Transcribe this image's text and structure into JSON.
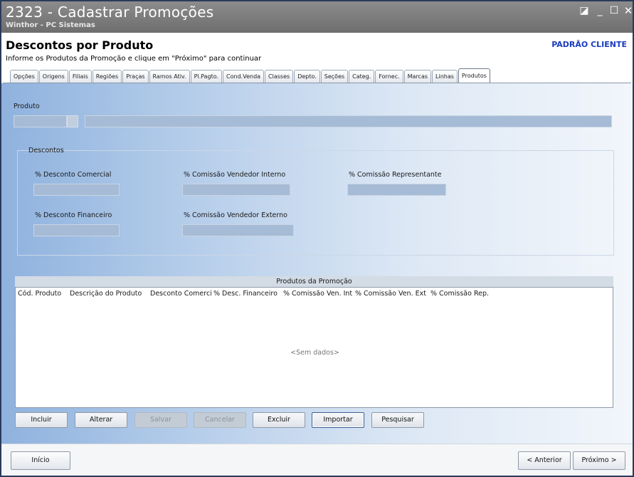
{
  "window": {
    "title": "2323 - Cadastrar Promoções",
    "subtitle": "Winthor - PC Sistemas",
    "controls": {
      "restore": "◪",
      "minimize": "_",
      "maximize": "☐",
      "close": "✕"
    }
  },
  "header": {
    "title": "Descontos por Produto",
    "instruction": "Informe os Produtos da Promoção e clique em \"Próximo\" para continuar",
    "profile_link": "PADRÃO CLIENTE"
  },
  "tabs": [
    {
      "label": "Opções"
    },
    {
      "label": "Origens"
    },
    {
      "label": "Filiais"
    },
    {
      "label": "Regiões"
    },
    {
      "label": "Praças"
    },
    {
      "label": "Ramos Ativ."
    },
    {
      "label": "Pl.Pagto."
    },
    {
      "label": "Cond.Venda"
    },
    {
      "label": "Classes"
    },
    {
      "label": "Depto."
    },
    {
      "label": "Seções"
    },
    {
      "label": "Categ."
    },
    {
      "label": "Fornec."
    },
    {
      "label": "Marcas"
    },
    {
      "label": "Linhas"
    },
    {
      "label": "Produtos"
    }
  ],
  "active_tab": "Produtos",
  "produto": {
    "label": "Produto",
    "code_value": "",
    "description_value": ""
  },
  "descontos": {
    "legend": "Descontos",
    "desconto_comercial_label": "% Desconto Comercial",
    "desconto_financeiro_label": "% Desconto Financeiro",
    "comissao_interno_label": "% Comissão Vendedor Interno",
    "comissao_externo_label": "% Comissão Vendedor Externo",
    "comissao_representante_label": "% Comissão Representante"
  },
  "grid": {
    "title": "Produtos da Promoção",
    "columns": [
      "Cód. Produto",
      "Descrição do Produto",
      "Desconto Comercial",
      "% Desc. Financeiro",
      "% Comissão Ven. Int",
      "% Comissão Ven. Ext",
      "% Comissão Rep."
    ],
    "empty_text": "<Sem dados>"
  },
  "actions": {
    "incluir": "Incluir",
    "alterar": "Alterar",
    "salvar": "Salvar",
    "cancelar": "Cancelar",
    "excluir": "Excluir",
    "importar": "Importar",
    "pesquisar": "Pesquisar"
  },
  "footer": {
    "inicio": "Início",
    "anterior": "< Anterior",
    "proximo": "Próximo >"
  },
  "colors": {
    "accent_link": "#1a3bbf",
    "field_fill": "#a6bbd5",
    "title_bar": "#7d7d7d"
  }
}
